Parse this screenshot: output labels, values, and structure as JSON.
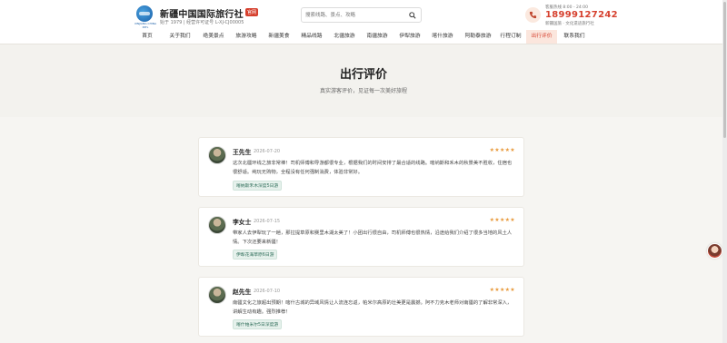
{
  "header": {
    "logo_icon": "globe-logo-icon",
    "logo_subtext": "XINJIANG CHINA INTL",
    "brand_name": "新疆中国国际旅行社",
    "brand_badge": "官网",
    "brand_tagline": "始于 1979 | 经营许可证号 L-XJ-CJ00005",
    "search_placeholder": "搜索线路、景点、攻略",
    "search_icon": "search-icon",
    "hotline_label": "客服热线 8:00 - 24:00",
    "hotline_number": "18999127242",
    "hotline_note": "新疆国旅 · 文化遗迹旅行社",
    "phone_icon": "phone-icon",
    "accent_color": "#d6402e"
  },
  "nav": {
    "items": [
      {
        "label": "首页"
      },
      {
        "label": "关于我们"
      },
      {
        "label": "绝美景点"
      },
      {
        "label": "旅游攻略"
      },
      {
        "label": "新疆美食"
      },
      {
        "label": "精品线路"
      },
      {
        "label": "北疆旅游"
      },
      {
        "label": "南疆旅游"
      },
      {
        "label": "伊犁旅游"
      },
      {
        "label": "喀什旅游"
      },
      {
        "label": "阿勒泰旅游"
      },
      {
        "label": "行程订制"
      },
      {
        "label": "出行评价"
      },
      {
        "label": "联系我们"
      }
    ],
    "active_label": "出行评价"
  },
  "hero": {
    "title": "出行评价",
    "subtitle": "真实游客评价，见证每一次美好旅程"
  },
  "reviews": [
    {
      "name": "王先生",
      "date": "2026-07-20",
      "stars": "★★★★★",
      "rating": 5,
      "text": "这次北疆环线之旅非常棒！司机师傅和导游都很专业，根据我们的时间安排了最合适的线路。喀纳斯和禾木的秋景美不胜收，住宿也很舒适。纯玩无购物，全程没有任何强制消费，体验非常好。",
      "tag": "喀纳斯禾木深度5日游"
    },
    {
      "name": "李女士",
      "date": "2026-07-15",
      "stars": "★★★★★",
      "rating": 5,
      "text": "带家人去伊犁玩了一趟，那拉提草原和赛里木湖太美了！小团出行很自由，司机师傅也很热情，沿途给我们介绍了很多当地的风土人情。下次还要来新疆！",
      "tag": "伊犁花海草原6日游"
    },
    {
      "name": "赵先生",
      "date": "2026-07-10",
      "stars": "★★★★★",
      "rating": 5,
      "text": "南疆文化之旅超出预期！喀什古城的异域风情让人流连忘返，帕米尔高原的壮美更是震撼。阿不力克木老师对南疆的了解非常深入，讲解生动有趣。强烈推荐！",
      "tag": "喀什帕米尔5日深度游"
    }
  ],
  "floating_service": {
    "icon": "customer-service-avatar-icon"
  }
}
